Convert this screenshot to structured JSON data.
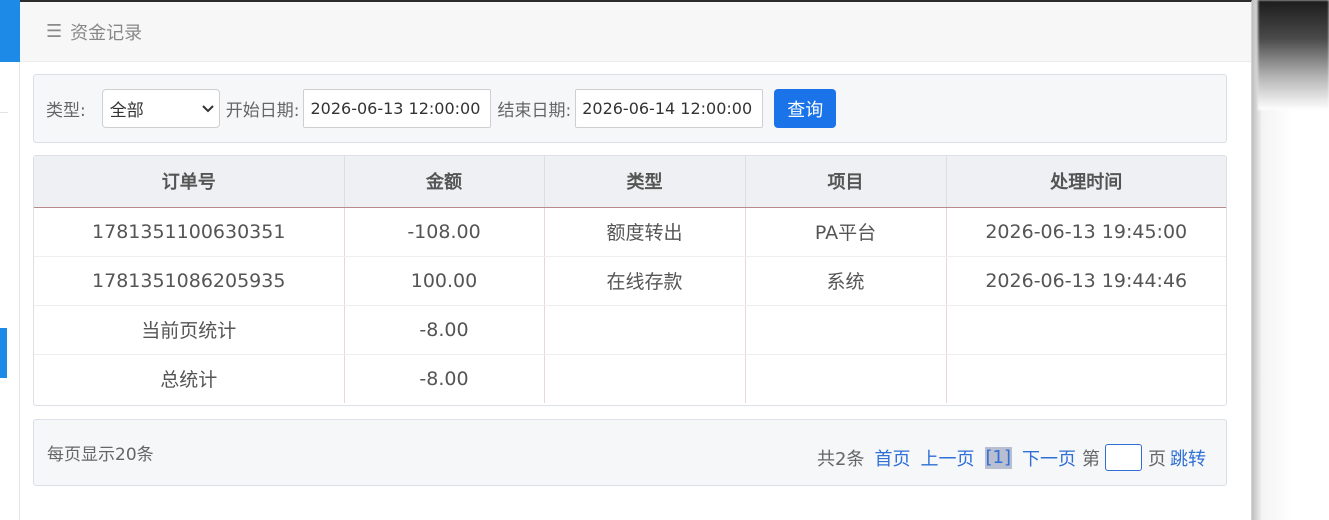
{
  "panel": {
    "title": "资金记录",
    "menu_icon": "menu-icon"
  },
  "filter": {
    "type_label": "类型:",
    "type_value": "全部",
    "start_label": "开始日期:",
    "start_value": "2026-06-13 12:00:00",
    "end_label": "结束日期:",
    "end_value": "2026-06-14 12:00:00",
    "query_label": "查询"
  },
  "table": {
    "headers": [
      "订单号",
      "金额",
      "类型",
      "项目",
      "处理时间"
    ],
    "rows": [
      [
        "1781351100630351",
        "-108.00",
        "额度转出",
        "PA平台",
        "2026-06-13 19:45:00"
      ],
      [
        "1781351086205935",
        "100.00",
        "在线存款",
        "系统",
        "2026-06-13 19:44:46"
      ],
      [
        "当前页统计",
        "-8.00",
        "",
        "",
        ""
      ],
      [
        "总统计",
        "-8.00",
        "",
        "",
        ""
      ]
    ]
  },
  "pager": {
    "page_size_text": "每页显示20条",
    "total_text": "共2条",
    "first": "首页",
    "prev": "上一页",
    "current": "[1]",
    "next": "下一页",
    "page_prefix": "第",
    "page_suffix": "页",
    "jump": "跳转"
  },
  "colors": {
    "accent": "#1a73e8",
    "link": "#2f6fd6"
  }
}
